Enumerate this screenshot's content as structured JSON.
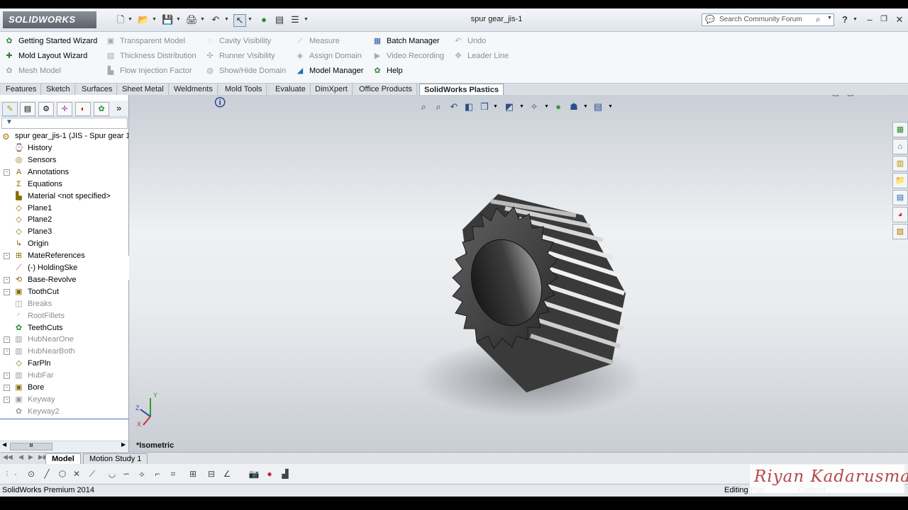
{
  "app": {
    "brand": "SOLIDWORKS",
    "doc_title": "spur gear_jis-1",
    "search_placeholder": "Search Community Forum",
    "help_icon": "?",
    "win_controls": [
      "minimize-icon",
      "restore-icon",
      "close-icon"
    ]
  },
  "command_manager": {
    "col1": [
      "Getting Started Wizard",
      "Mold Layout Wizard",
      "Mesh Model"
    ],
    "col2": [
      "Transparent Model",
      "Thickness Distribution",
      "Flow Injection Factor"
    ],
    "col3": [
      "Cavity Visibility",
      "Runner Visibility",
      "Show/Hide Domain"
    ],
    "col4": [
      "Measure",
      "Assign Domain",
      "Model Manager"
    ],
    "col5": [
      "Batch Manager",
      "Video Recording",
      "Help"
    ],
    "col6": [
      "Undo",
      "Leader Line"
    ]
  },
  "tabs": [
    "Features",
    "Sketch",
    "Surfaces",
    "Sheet Metal",
    "Weldments",
    "Mold Tools",
    "Evaluate",
    "DimXpert",
    "Office Products",
    "SolidWorks Plastics"
  ],
  "active_tab": "SolidWorks Plastics",
  "tree": {
    "root": "spur gear_jis-1  (JIS - Spur gear 1",
    "items": [
      {
        "label": "History",
        "icon": "history-icon",
        "dim": false
      },
      {
        "label": "Sensors",
        "icon": "sensors-icon",
        "dim": false
      },
      {
        "label": "Annotations",
        "icon": "annotations-icon",
        "dim": false
      },
      {
        "label": "Equations",
        "icon": "equations-icon",
        "dim": false
      },
      {
        "label": "Material <not specified>",
        "icon": "material-icon",
        "dim": false
      },
      {
        "label": "Plane1",
        "icon": "plane-icon",
        "dim": false
      },
      {
        "label": "Plane2",
        "icon": "plane-icon",
        "dim": false
      },
      {
        "label": "Plane3",
        "icon": "plane-icon",
        "dim": false
      },
      {
        "label": "Origin",
        "icon": "origin-icon",
        "dim": false
      },
      {
        "label": "MateReferences",
        "icon": "mate-references-icon",
        "dim": false
      },
      {
        "label": "(-) HoldingSke",
        "icon": "sketch-icon",
        "dim": false
      },
      {
        "label": "Base-Revolve",
        "icon": "revolve-icon",
        "dim": false
      },
      {
        "label": "ToothCut",
        "icon": "cut-icon",
        "dim": false
      },
      {
        "label": "Breaks",
        "icon": "breaks-icon",
        "dim": true
      },
      {
        "label": "RootFillets",
        "icon": "fillet-icon",
        "dim": true
      },
      {
        "label": "TeethCuts",
        "icon": "pattern-icon",
        "dim": false
      },
      {
        "label": "HubNearOne",
        "icon": "extrude-icon",
        "dim": true
      },
      {
        "label": "HubNearBoth",
        "icon": "extrude-icon",
        "dim": true
      },
      {
        "label": "FarPln",
        "icon": "plane-icon",
        "dim": false
      },
      {
        "label": "HubFar",
        "icon": "extrude-icon",
        "dim": true
      },
      {
        "label": "Bore",
        "icon": "cut-icon",
        "dim": false
      },
      {
        "label": "Keyway",
        "icon": "cut-icon",
        "dim": true
      },
      {
        "label": "Keyway2",
        "icon": "pattern-icon",
        "dim": true
      }
    ]
  },
  "viewport": {
    "view_label": "*Isometric",
    "axis_labels": {
      "x": "X",
      "y": "Y",
      "z": "Z"
    }
  },
  "bottom_tabs": [
    "Model",
    "Motion Study 1"
  ],
  "status": {
    "left": "SolidWorks Premium 2014",
    "editing": "Editing Part",
    "units": "Custom"
  },
  "watermark": "Riyan Kadarusman"
}
